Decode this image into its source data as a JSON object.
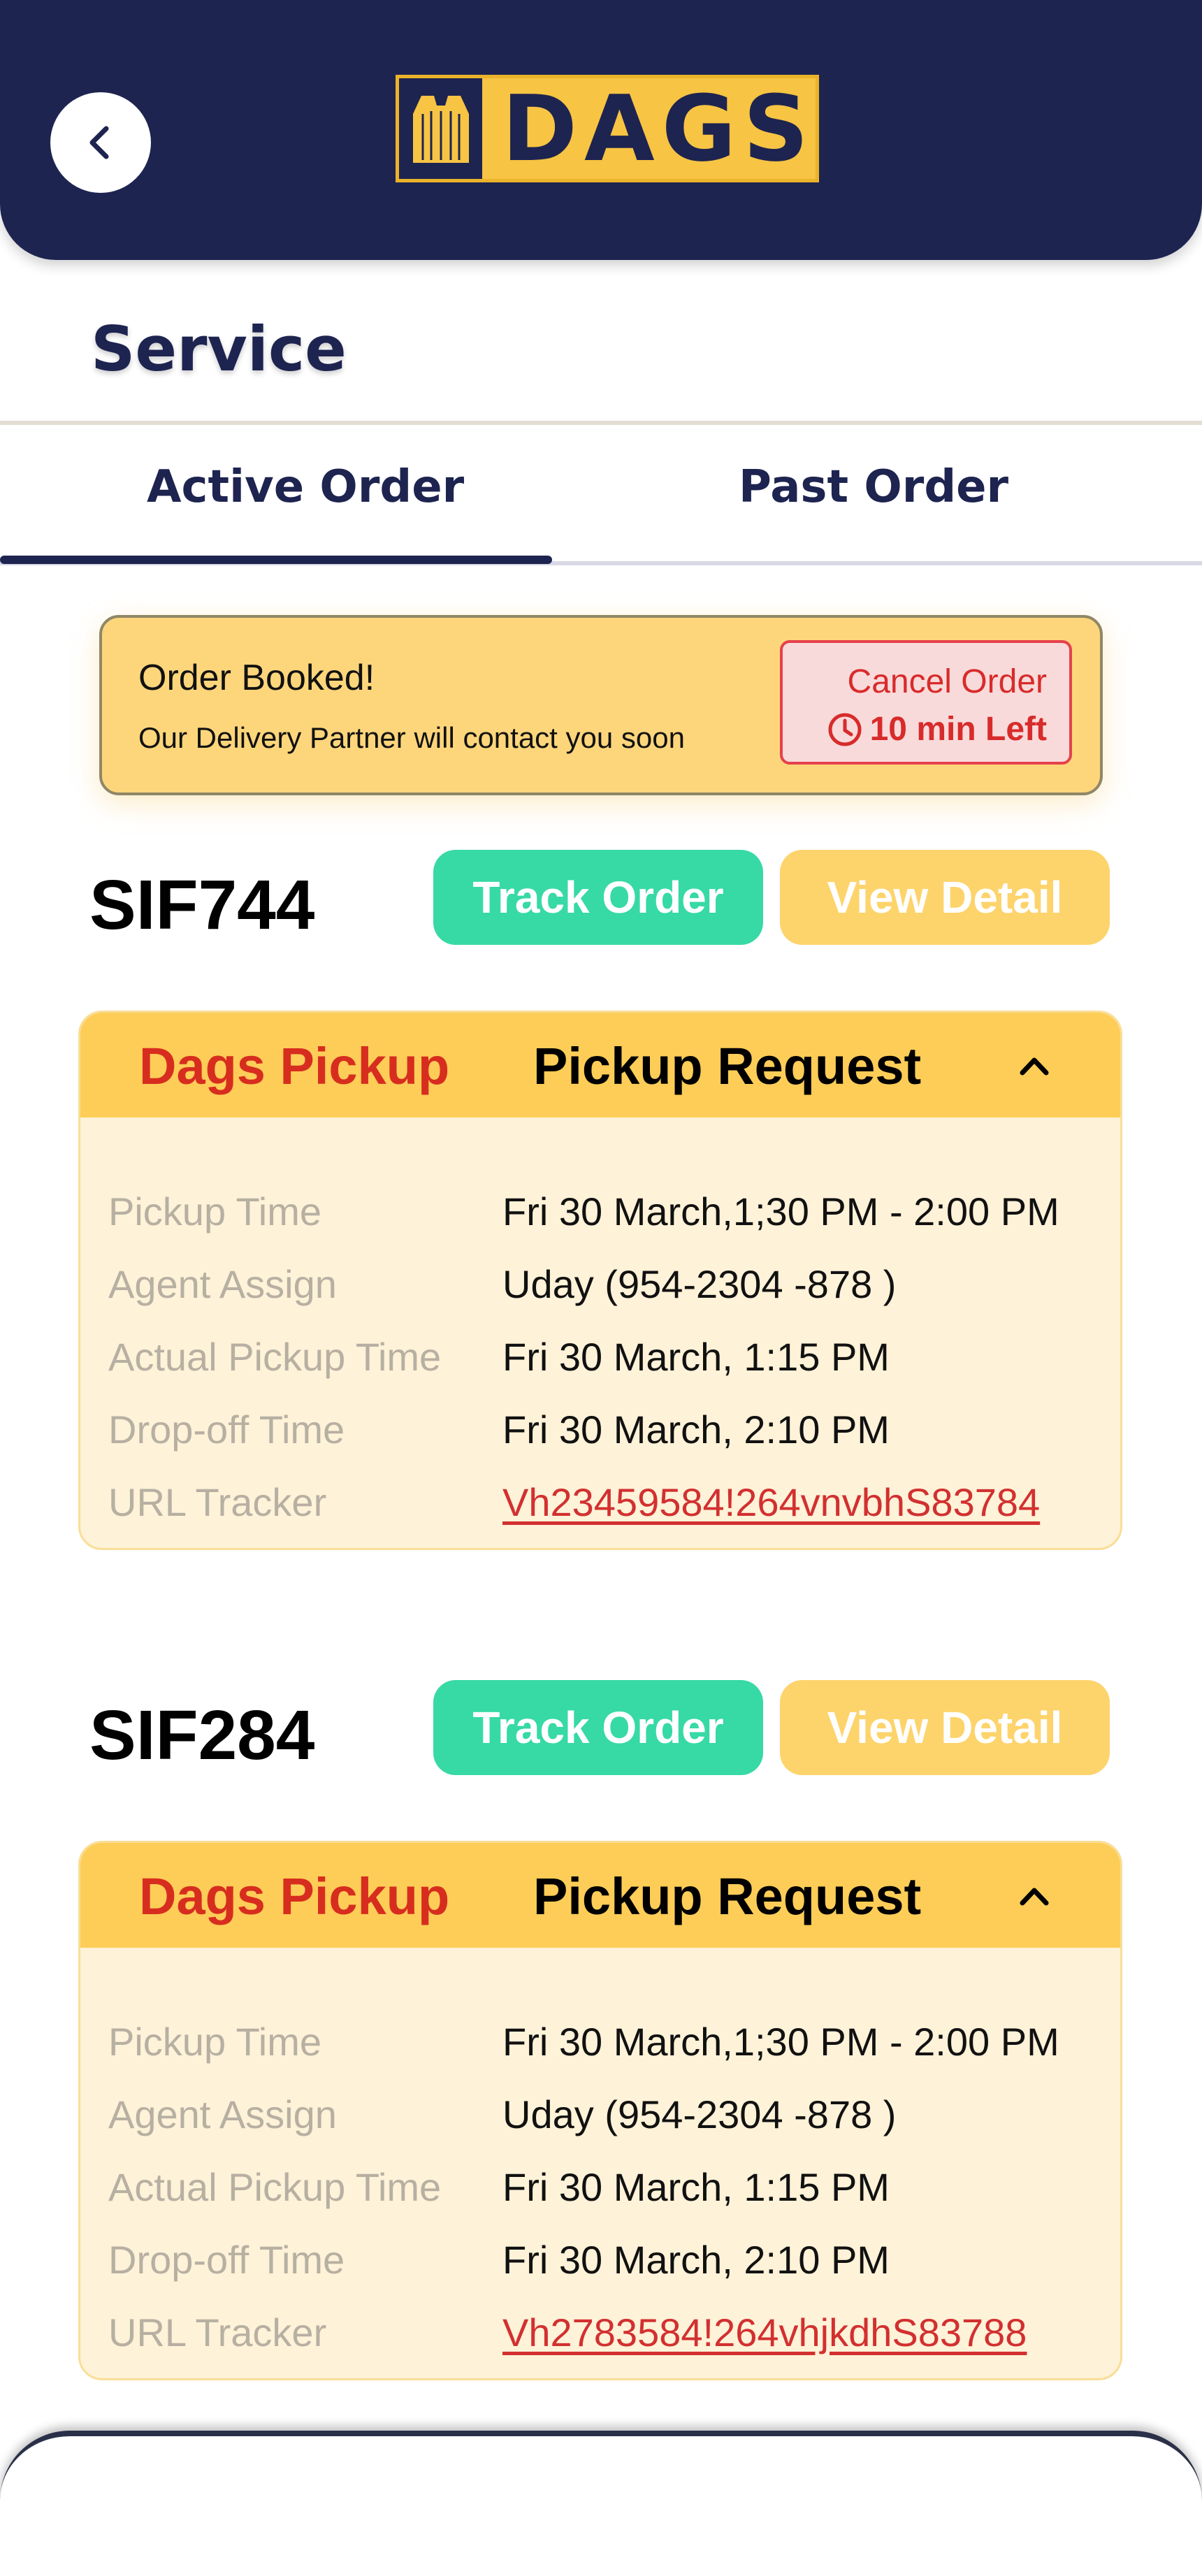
{
  "header": {
    "back_icon": "chevron-left-icon",
    "logo_text": "DAGS",
    "logo_icon": "bag-icon",
    "colors": {
      "navy": "#1e2450",
      "gold": "#f7c443"
    }
  },
  "page_title": "Service",
  "tabs": [
    {
      "label": "Active Order",
      "active": true
    },
    {
      "label": "Past Order",
      "active": false
    }
  ],
  "banner": {
    "title": "Order Booked!",
    "subtitle": "Our Delivery Partner will contact you soon",
    "cancel_label": "Cancel Order",
    "timer_icon": "clock-icon",
    "timer_text": "10 min Left"
  },
  "buttons": {
    "track": "Track Order",
    "view": "View Detail"
  },
  "orders": [
    {
      "id": "SIF744",
      "tag": "Dags Pickup",
      "type": "Pickup Request",
      "expand_icon": "chevron-up-icon",
      "rows": [
        {
          "label": "Pickup Time",
          "value": "Fri 30 March,1;30 PM - 2:00 PM"
        },
        {
          "label": "Agent Assign",
          "value": "Uday (954-2304 -878 )"
        },
        {
          "label": "Actual Pickup Time",
          "value": "Fri 30 March, 1:15 PM"
        },
        {
          "label": "Drop-off Time",
          "value": "Fri 30 March, 2:10 PM"
        },
        {
          "label": "URL Tracker",
          "value": "Vh23459584!264vnvbhS83784"
        }
      ]
    },
    {
      "id": "SIF284",
      "tag": "Dags Pickup",
      "type": "Pickup Request",
      "expand_icon": "chevron-up-icon",
      "rows": [
        {
          "label": "Pickup Time",
          "value": "Fri 30 March,1;30 PM - 2:00 PM"
        },
        {
          "label": "Agent Assign",
          "value": "Uday (954-2304 -878 )"
        },
        {
          "label": "Actual Pickup Time",
          "value": "Fri 30 March, 1:15 PM"
        },
        {
          "label": "Drop-off Time",
          "value": "Fri 30 March, 2:10 PM"
        },
        {
          "label": "URL Tracker",
          "value": "Vh2783584!264vhjkdhS83788"
        }
      ]
    }
  ]
}
